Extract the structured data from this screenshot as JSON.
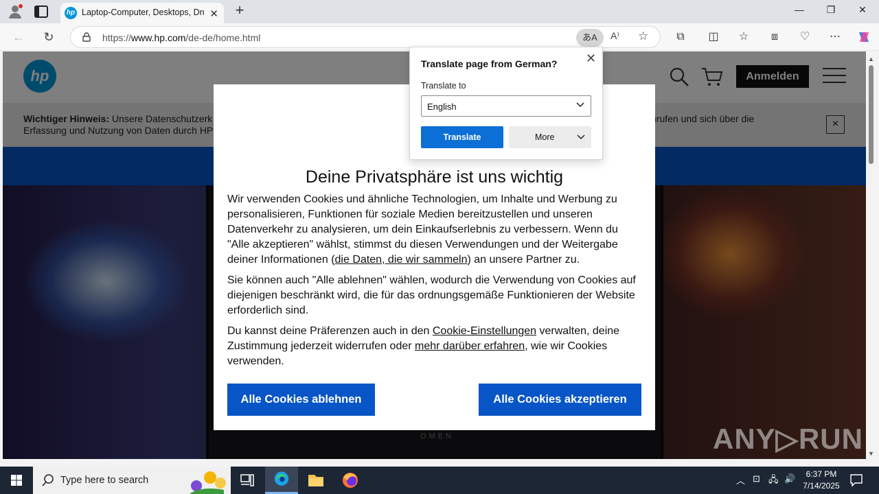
{
  "browser": {
    "tab_title": "Laptop-Computer, Desktops, Drucker",
    "tab_favicon_text": "hp",
    "url_prefix": "https://",
    "url_host": "www.hp.com",
    "url_path": "/de-de/home.html",
    "translate_icon_glyph": "あA",
    "read_aloud_glyph": "A⁾"
  },
  "site": {
    "logo_text": "hp",
    "login_label": "Anmelden",
    "notice_bold": "Wichtiger Hinweis:",
    "notice_line1": "Unsere Datenschutzerk",
    "notice_line1_right": "urufen und sich über die",
    "notice_line2": "Erfassung und Nutzung von Daten durch HP",
    "notice_close": "×",
    "hero_brand": "OMEN",
    "watermark": "ANY▷RUN"
  },
  "cookie_dialog": {
    "title": "Deine Privatsphäre ist uns wichtig",
    "p1_before": "Wir verwenden Cookies und ähnliche Technologien, um Inhalte und Werbung zu personalisieren, Funktionen für soziale Medien bereitzustellen und unseren Datenverkehr zu analysieren, um dein Einkaufserlebnis zu verbessern. Wenn du \"Alle akzeptieren\" wählst, stimmst du diesen Verwendungen und der Weitergabe deiner Informationen (",
    "p1_link": "die Daten, die wir sammeln",
    "p1_after": ") an unsere Partner zu.",
    "p2": "Sie können auch \"Alle ablehnen\" wählen, wodurch die Verwendung von Cookies auf diejenigen beschränkt wird, die für das ordnungsgemäße Funktionieren der Website erforderlich sind.",
    "p3_before": "Du kannst deine Präferenzen auch in den ",
    "p3_link1": "Cookie-Einstellungen",
    "p3_mid": " verwalten, deine Zustimmung jederzeit widerrufen oder ",
    "p3_link2": "mehr darüber erfahren",
    "p3_after": ", wie wir Cookies verwenden.",
    "decline_label": "Alle Cookies ablehnen",
    "accept_label": "Alle Cookies akzeptieren"
  },
  "translate_popup": {
    "heading": "Translate page from German?",
    "translate_to_label": "Translate to",
    "selected_language": "English",
    "translate_button": "Translate",
    "more_button": "More"
  },
  "taskbar": {
    "search_placeholder": "Type here to search",
    "time": "6:37 PM",
    "date": "7/14/2025"
  },
  "colors": {
    "hp_blue": "#0096d6",
    "cookie_button_blue": "#0755c6",
    "translate_button_blue": "#0c6fd6",
    "taskbar_bg": "#1c2634"
  }
}
